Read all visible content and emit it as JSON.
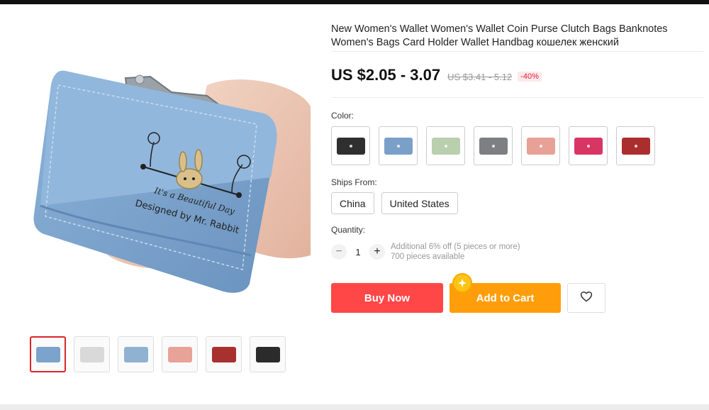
{
  "product": {
    "title": "New Women's Wallet Women's Wallet Coin Purse Clutch Bags Banknotes Women's Bags Card Holder Wallet Handbag кошелек женский",
    "price": "US $2.05 - 3.07",
    "old_price": "US $3.41 - 5.12",
    "discount": "-40%",
    "main_image_text_line1": "It's a Beautiful Day",
    "main_image_text_line2": "Designed by Mr. Rabbit"
  },
  "thumbnails": [
    {
      "name": "blue-wallet",
      "color": "#7ba3cc",
      "active": true
    },
    {
      "name": "open-wallet",
      "color": "#d9d9d9",
      "active": false
    },
    {
      "name": "wallet-in-hand",
      "color": "#8fb2d1",
      "active": false
    },
    {
      "name": "pink-wallet",
      "color": "#e8a298",
      "active": false
    },
    {
      "name": "red-wallet",
      "color": "#a8302e",
      "active": false
    },
    {
      "name": "black-wallet",
      "color": "#2b2b2b",
      "active": false
    }
  ],
  "color_section": {
    "label": "Color:",
    "options": [
      {
        "name": "black",
        "hex": "#2f2f2f"
      },
      {
        "name": "blue",
        "hex": "#7ba0c8"
      },
      {
        "name": "green",
        "hex": "#b9cfae"
      },
      {
        "name": "gray",
        "hex": "#7d7f82"
      },
      {
        "name": "pink",
        "hex": "#e8a196"
      },
      {
        "name": "rose",
        "hex": "#d83565"
      },
      {
        "name": "red",
        "hex": "#ab2e2e"
      }
    ]
  },
  "ships_from": {
    "label": "Ships From:",
    "options": [
      "China",
      "United States"
    ]
  },
  "quantity": {
    "label": "Quantity:",
    "minus": "−",
    "plus": "+",
    "value": "1",
    "note_line1": "Additional 6% off (5 pieces or more)",
    "note_line2": "700 pieces available"
  },
  "actions": {
    "buy_now": "Buy Now",
    "add_to_cart": "Add to Cart"
  },
  "icons": {
    "wishlist": "heart-icon",
    "coin": "coin-icon"
  },
  "colors": {
    "buy_now": "#ff4747",
    "add_to_cart": "#ff9e0a",
    "discount": "#e0223a",
    "active_thumb_border": "#d9262b"
  }
}
